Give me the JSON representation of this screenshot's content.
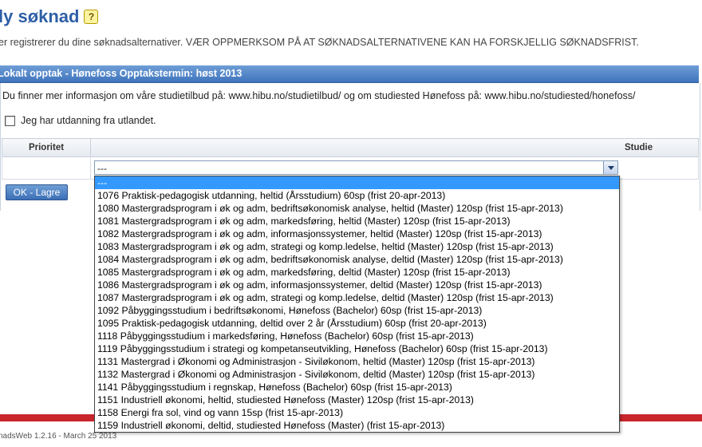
{
  "page": {
    "title": "ly søknad",
    "intro": "er registrerer du dine søknadsalternativer. VÆR OPPMERKSOM PÅ AT SØKNADSALTERNATIVENE KAN HA FORSKJELLIG SØKNADSFRIST."
  },
  "panel": {
    "header": "Lokalt opptak - Hønefoss Opptakstermin: høst 2013",
    "info": "Du finner mer informasjon om våre studietilbud på: www.hibu.no/studietilbud/ og om studiested Hønefoss på: www.hibu.no/studiested/honefoss/",
    "abroad_label": "Jeg har utdanning fra utlandet."
  },
  "table": {
    "col_priority": "Prioritet",
    "col_study": "Studie"
  },
  "select": {
    "value": "---",
    "options": [
      "---",
      "1076 Praktisk-pedagogisk utdanning, heltid (Årsstudium) 60sp (frist 20-apr-2013)",
      "1080 Mastergradsprogram i øk og adm, bedriftsøkonomisk analyse, heltid (Master) 120sp (frist 15-apr-2013)",
      "1081 Mastergradsprogram i øk og adm, markedsføring, heltid (Master) 120sp (frist 15-apr-2013)",
      "1082 Mastergradsprogram i øk og adm, informasjonssystemer, heltid (Master) 120sp (frist 15-apr-2013)",
      "1083 Mastergradsprogram i øk og adm, strategi og komp.ledelse, heltid (Master) 120sp (frist 15-apr-2013)",
      "1084 Mastergradsprogram i øk og adm, bedriftsøkonomisk analyse, deltid (Master) 120sp (frist 15-apr-2013)",
      "1085 Mastergradsprogram i øk og adm, markedsføring, deltid (Master) 120sp (frist 15-apr-2013)",
      "1086 Mastergradsprogram i øk og adm, informasjonssystemer, deltid (Master) 120sp (frist 15-apr-2013)",
      "1087 Mastergradsprogram i øk og adm, strategi og komp.ledelse, deltid (Master) 120sp (frist 15-apr-2013)",
      "1092 Påbyggingsstudium i bedriftsøkonomi, Hønefoss (Bachelor) 60sp (frist 15-apr-2013)",
      "1095 Praktisk-pedagogisk utdanning, deltid over 2 år (Årsstudium) 60sp (frist 20-apr-2013)",
      "1118 Påbyggingsstudium i markedsføring, Hønefoss (Bachelor) 60sp (frist 15-apr-2013)",
      "1119 Påbyggingsstudium i strategi og kompetanseutvikling, Hønefoss (Bachelor) 60sp (frist 15-apr-2013)",
      "1131 Mastergrad i Økonomi og Administrasjon - Siviløkonom, heltid (Master) 120sp (frist 15-apr-2013)",
      "1132 Mastergrad i Økonomi og Administrasjon - Siviløkonom, deltid (Master) 120sp (frist 15-apr-2013)",
      "1141 Påbyggingsstudium i regnskap, Hønefoss (Bachelor) 60sp (frist 15-apr-2013)",
      "1151 Industriell økonomi, heltid, studiested Hønefoss (Master) 120sp (frist 15-apr-2013)",
      "1158 Energi fra sol, vind og vann 15sp (frist 15-apr-2013)",
      "1159 Industriell økonomi, deltid, studiested Hønefoss (Master) (frist 15-apr-2013)"
    ]
  },
  "buttons": {
    "ok_save": "OK - Lagre"
  },
  "footer": {
    "version": "nadsWeb 1.2.16 - March 25 2013"
  },
  "colors": {
    "title_blue": "#2d5fa6",
    "header_blue": "#3f74bd",
    "selection_blue": "#3399ff",
    "footer_red": "#c8252c"
  },
  "icons": {
    "help": "help-speech-bubble-icon"
  }
}
